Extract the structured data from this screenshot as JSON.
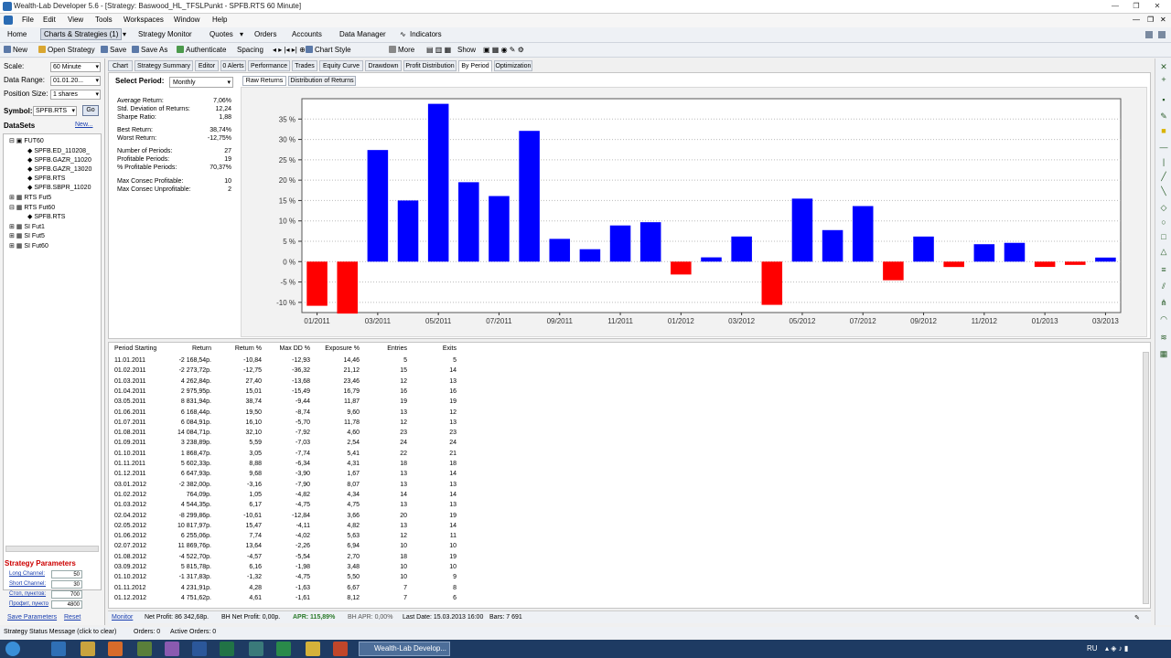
{
  "window": {
    "title": "Wealth-Lab Developer 5.6 - [Strategy: Baswood_HL_TFSLPunkt - SPFB.RTS 60 Minute]",
    "controls": [
      "—",
      "❐",
      "✕"
    ],
    "inner_controls": [
      "—",
      "❐",
      "✕"
    ]
  },
  "menu": [
    "File",
    "Edit",
    "View",
    "Tools",
    "Workspaces",
    "Window",
    "Help"
  ],
  "nav": {
    "home": "Home",
    "charts": "Charts & Strategies (1)",
    "items": [
      "Strategy Monitor",
      "Quotes",
      "Orders",
      "Accounts",
      "Data Manager",
      "Indicators"
    ]
  },
  "toolbar": {
    "new": "New",
    "open": "Open Strategy",
    "save": "Save",
    "save_as": "Save As",
    "authenticate": "Authenticate",
    "spacing": "Spacing",
    "chart_style": "Chart Style",
    "more": "More",
    "show": "Show"
  },
  "left": {
    "scale_label": "Scale:",
    "scale_value": "60 Minute",
    "range_label": "Data Range:",
    "range_value": "01.01.20...",
    "position_label": "Position Size:",
    "position_value": "1 shares",
    "symbol_label": "Symbol:",
    "symbol_value": "SPFB.RTS",
    "go": "Go",
    "datasets": "DataSets",
    "new_link": "New...",
    "tree": [
      "FUT60",
      "SPFB.ED_110208_",
      "SPFB.GAZR_11020",
      "SPFB.GAZR_13020",
      "SPFB.RTS",
      "SPFB.SBPR_11020",
      "RTS Fut5",
      "RTS Fut60",
      "SPFB.RTS",
      "SI Fut1",
      "SI Fut5",
      "SI Fut60"
    ],
    "params_title": "Strategy Parameters",
    "params": [
      {
        "name": "Long Channel:",
        "value": "50"
      },
      {
        "name": "Short Channel:",
        "value": "30"
      },
      {
        "name": "Стоп, пунктов:",
        "value": "700"
      },
      {
        "name": "Профит, пункто",
        "value": "4800"
      }
    ],
    "save_params": "Save Parameters",
    "reset": "Reset"
  },
  "tabs": [
    "Chart",
    "Strategy Summary",
    "Editor",
    "0 Alerts",
    "Performance",
    "Trades",
    "Equity Curve",
    "Drawdown",
    "Profit Distribution",
    "By Period",
    "Optimization"
  ],
  "period": {
    "label": "Select Period:",
    "value": "Monthly",
    "stats": [
      {
        "label": "Average Return:",
        "value": "7,06%"
      },
      {
        "label": "Std. Deviation of Returns:",
        "value": "12,24"
      },
      {
        "label": "Sharpe Ratio:",
        "value": "1,88"
      },
      {
        "label": "Best Return:",
        "value": "38,74%"
      },
      {
        "label": "Worst Return:",
        "value": "-12,75%"
      },
      {
        "label": "Number of Periods:",
        "value": "27"
      },
      {
        "label": "Profitable Periods:",
        "value": "19"
      },
      {
        "label": "% Profitable Periods:",
        "value": "70,37%"
      },
      {
        "label": "Max Consec Profitable:",
        "value": "10"
      },
      {
        "label": "Max Consec Unprofitable:",
        "value": "2"
      }
    ]
  },
  "subtabs": [
    "Raw Returns",
    "Distribution of Returns"
  ],
  "chart_data": {
    "type": "bar",
    "ylim": [
      -12.5,
      40
    ],
    "yticks": [
      -10,
      -5,
      0,
      5,
      10,
      15,
      20,
      25,
      30,
      35
    ],
    "ytick_labels": [
      "-10 %",
      "-5 %",
      "0 %",
      "5 %",
      "10 %",
      "15 %",
      "20 %",
      "25 %",
      "30 %",
      "35 %"
    ],
    "xtick_labels": [
      "01/2011",
      "03/2011",
      "05/2011",
      "07/2011",
      "09/2011",
      "11/2011",
      "01/2012",
      "03/2012",
      "05/2012",
      "07/2012",
      "09/2012",
      "11/2012",
      "01/2013",
      "03/2013"
    ],
    "categories": [
      "01/2011",
      "02/2011",
      "03/2011",
      "04/2011",
      "05/2011",
      "06/2011",
      "07/2011",
      "08/2011",
      "09/2011",
      "10/2011",
      "11/2011",
      "12/2011",
      "01/2012",
      "02/2012",
      "03/2012",
      "04/2012",
      "05/2012",
      "06/2012",
      "07/2012",
      "08/2012",
      "09/2012",
      "10/2012",
      "11/2012",
      "12/2012",
      "01/2013",
      "02/2013",
      "03/2013"
    ],
    "values": [
      -10.84,
      -12.75,
      27.4,
      15.01,
      38.74,
      19.5,
      16.1,
      32.1,
      5.59,
      3.05,
      8.88,
      9.68,
      -3.16,
      1.05,
      6.17,
      -10.61,
      15.47,
      7.74,
      13.64,
      -4.57,
      6.16,
      -1.32,
      4.28,
      4.61,
      -1.3,
      -0.8,
      1.0
    ],
    "colors": {
      "positive": "#0000ff",
      "negative": "#ff0000"
    }
  },
  "table": {
    "headers": [
      "Period Starting",
      "Return",
      "Return %",
      "Max DD %",
      "Exposure %",
      "Entries",
      "Exits"
    ],
    "rows": [
      [
        "11.01.2011",
        "-2 168,54p.",
        "-10,84",
        "-12,93",
        "14,46",
        "5",
        "5"
      ],
      [
        "01.02.2011",
        "-2 273,72p.",
        "-12,75",
        "-36,32",
        "21,12",
        "15",
        "14"
      ],
      [
        "01.03.2011",
        "4 262,84p.",
        "27,40",
        "-13,68",
        "23,46",
        "12",
        "13"
      ],
      [
        "01.04.2011",
        "2 975,95p.",
        "15,01",
        "-15,49",
        "16,79",
        "16",
        "16"
      ],
      [
        "03.05.2011",
        "8 831,94p.",
        "38,74",
        "-9,44",
        "11,87",
        "19",
        "19"
      ],
      [
        "01.06.2011",
        "6 168,44p.",
        "19,50",
        "-8,74",
        "9,60",
        "13",
        "12"
      ],
      [
        "01.07.2011",
        "6 084,91p.",
        "16,10",
        "-5,70",
        "11,78",
        "12",
        "13"
      ],
      [
        "01.08.2011",
        "14 084,71p.",
        "32,10",
        "-7,92",
        "4,60",
        "23",
        "23"
      ],
      [
        "01.09.2011",
        "3 238,89p.",
        "5,59",
        "-7,03",
        "2,54",
        "24",
        "24"
      ],
      [
        "01.10.2011",
        "1 868,47p.",
        "3,05",
        "-7,74",
        "5,41",
        "22",
        "21"
      ],
      [
        "01.11.2011",
        "5 602,33p.",
        "8,88",
        "-6,34",
        "4,31",
        "18",
        "18"
      ],
      [
        "01.12.2011",
        "6 647,93p.",
        "9,68",
        "-3,90",
        "1,67",
        "13",
        "14"
      ],
      [
        "03.01.2012",
        "-2 382,00p.",
        "-3,16",
        "-7,90",
        "8,07",
        "13",
        "13"
      ],
      [
        "01.02.2012",
        "764,09p.",
        "1,05",
        "-4,82",
        "4,34",
        "14",
        "14"
      ],
      [
        "01.03.2012",
        "4 544,35p.",
        "6,17",
        "-4,75",
        "4,75",
        "13",
        "13"
      ],
      [
        "02.04.2012",
        "-8 299,86p.",
        "-10,61",
        "-12,84",
        "3,66",
        "20",
        "19"
      ],
      [
        "02.05.2012",
        "10 817,97p.",
        "15,47",
        "-4,11",
        "4,82",
        "13",
        "14"
      ],
      [
        "01.06.2012",
        "6 255,06p.",
        "7,74",
        "-4,02",
        "5,63",
        "12",
        "11"
      ],
      [
        "02.07.2012",
        "11 869,76p.",
        "13,64",
        "-2,26",
        "6,94",
        "10",
        "10"
      ],
      [
        "01.08.2012",
        "-4 522,70p.",
        "-4,57",
        "-5,54",
        "2,70",
        "18",
        "19"
      ],
      [
        "03.09.2012",
        "5 815,78p.",
        "6,16",
        "-1,98",
        "3,48",
        "10",
        "10"
      ],
      [
        "01.10.2012",
        "-1 317,83p.",
        "-1,32",
        "-4,75",
        "5,50",
        "10",
        "9"
      ],
      [
        "01.11.2012",
        "4 231,91p.",
        "4,28",
        "-1,63",
        "6,67",
        "7",
        "8"
      ],
      [
        "01.12.2012",
        "4 751,62p.",
        "4,61",
        "-1,61",
        "8,12",
        "7",
        "6"
      ]
    ]
  },
  "status": {
    "monitor": "Monitor",
    "net_profit": "Net Profit: 86 342,68p.",
    "bh_net": "BH Net Profit: 0,00p.",
    "apr": "APR: 115,89%",
    "bh_apr": "BH APR: 0,00%",
    "last_date": "Last Date: 15.03.2013 16:00",
    "bars": "Bars: 7 691"
  },
  "status2": {
    "message": "Strategy Status Message (click to clear)",
    "orders": "Orders: 0",
    "active_orders": "Active Orders: 0"
  },
  "taskbar": {
    "window": "Wealth-Lab Develop...",
    "lang": "RU"
  }
}
